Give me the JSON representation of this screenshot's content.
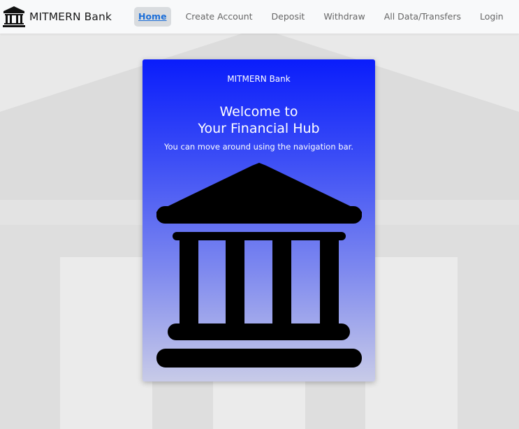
{
  "navbar": {
    "brand": {
      "icon": "bank-icon",
      "title": "MITMERN Bank"
    },
    "items": [
      {
        "label": "Home",
        "active": true
      },
      {
        "label": "Create Account",
        "active": false
      },
      {
        "label": "Deposit",
        "active": false
      },
      {
        "label": "Withdraw",
        "active": false
      },
      {
        "label": "All Data/Transfers",
        "active": false
      },
      {
        "label": "Login",
        "active": false
      }
    ]
  },
  "card": {
    "header": "MITMERN Bank",
    "title_line1": "Welcome to",
    "title_line2": "Your Financial Hub",
    "text": "You can move around using the navigation bar.",
    "illustration": "bank-icon"
  },
  "colors": {
    "active_link": "#1d6fd8",
    "card_gradient_top": "#0a1dfb",
    "card_gradient_bottom": "#c8cbe8"
  }
}
